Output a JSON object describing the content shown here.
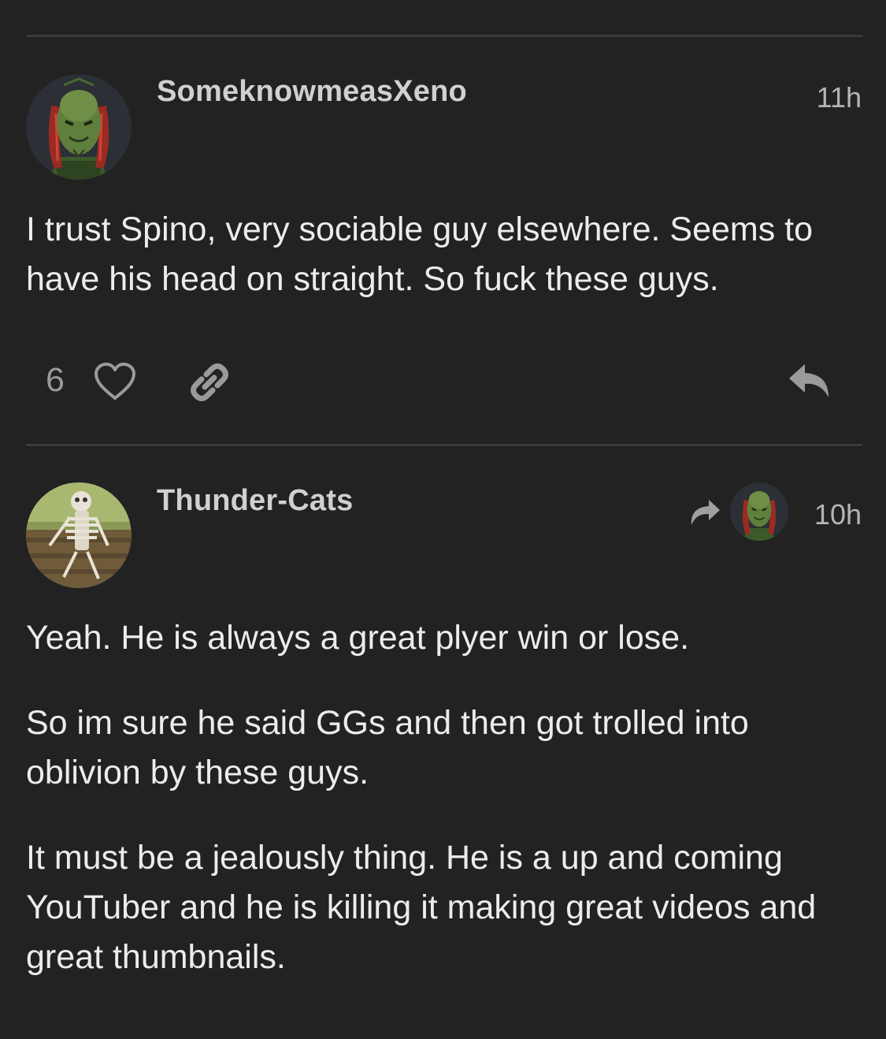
{
  "posts": [
    {
      "username": "SomeknowmeasXeno",
      "time": "11h",
      "avatar_icon": "alien-predator-avatar",
      "paragraphs": [
        "I trust Spino, very sociable guy elsewhere. Seems to have his head on straight. So fuck these guys."
      ],
      "like_count": "6",
      "actions": [
        "heart-icon",
        "link-icon",
        "reply-icon"
      ]
    },
    {
      "username": "Thunder-Cats",
      "time": "10h",
      "avatar_icon": "skeleton-on-bench-avatar",
      "reply_to_icon": "reply-arrow-icon",
      "reply_to_avatar": "alien-predator-avatar",
      "paragraphs": [
        "Yeah. He is always a great plyer win or lose.",
        "So im sure he said GGs and then got trolled into oblivion by these guys.",
        "It must be a jealously thing. He is a up and coming YouTuber and he is killing it making great videos and great thumbnails."
      ]
    }
  ],
  "colors": {
    "background": "#222222",
    "divider": "#3a3a3a",
    "text": "#ececec",
    "muted": "#9a9a9a"
  }
}
